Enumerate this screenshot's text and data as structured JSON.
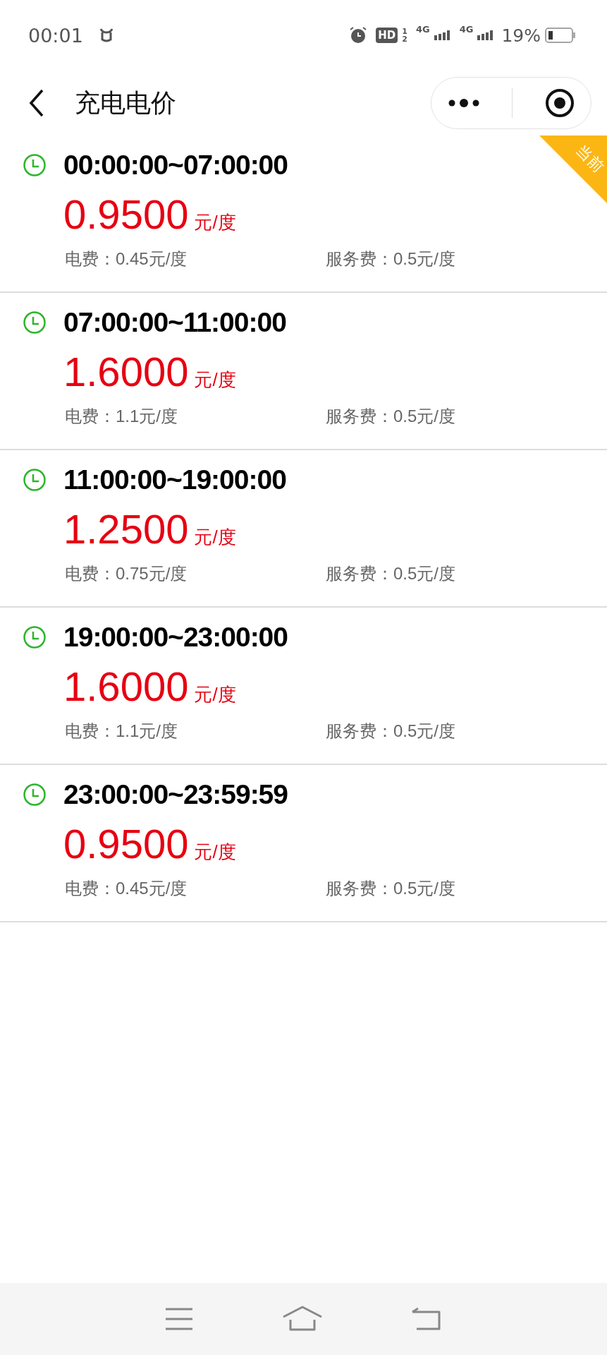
{
  "status_bar": {
    "time": "00:01",
    "hd_label": "HD",
    "hd_sub": "1",
    "hd_sub2": "2",
    "network_1": "4G",
    "network_2": "4G",
    "battery": "19%"
  },
  "header": {
    "title": "充电电价"
  },
  "periods": [
    {
      "time": "00:00:00~07:00:00",
      "price": "0.9500",
      "unit": "元/度",
      "electricity_fee": "电费：0.45元/度",
      "service_fee": "服务费：0.5元/度",
      "badge": "当前"
    },
    {
      "time": "07:00:00~11:00:00",
      "price": "1.6000",
      "unit": "元/度",
      "electricity_fee": "电费：1.1元/度",
      "service_fee": "服务费：0.5元/度"
    },
    {
      "time": "11:00:00~19:00:00",
      "price": "1.2500",
      "unit": "元/度",
      "electricity_fee": "电费：0.75元/度",
      "service_fee": "服务费：0.5元/度"
    },
    {
      "time": "19:00:00~23:00:00",
      "price": "1.6000",
      "unit": "元/度",
      "electricity_fee": "电费：1.1元/度",
      "service_fee": "服务费：0.5元/度"
    },
    {
      "time": "23:00:00~23:59:59",
      "price": "0.9500",
      "unit": "元/度",
      "electricity_fee": "电费：0.45元/度",
      "service_fee": "服务费：0.5元/度"
    }
  ]
}
